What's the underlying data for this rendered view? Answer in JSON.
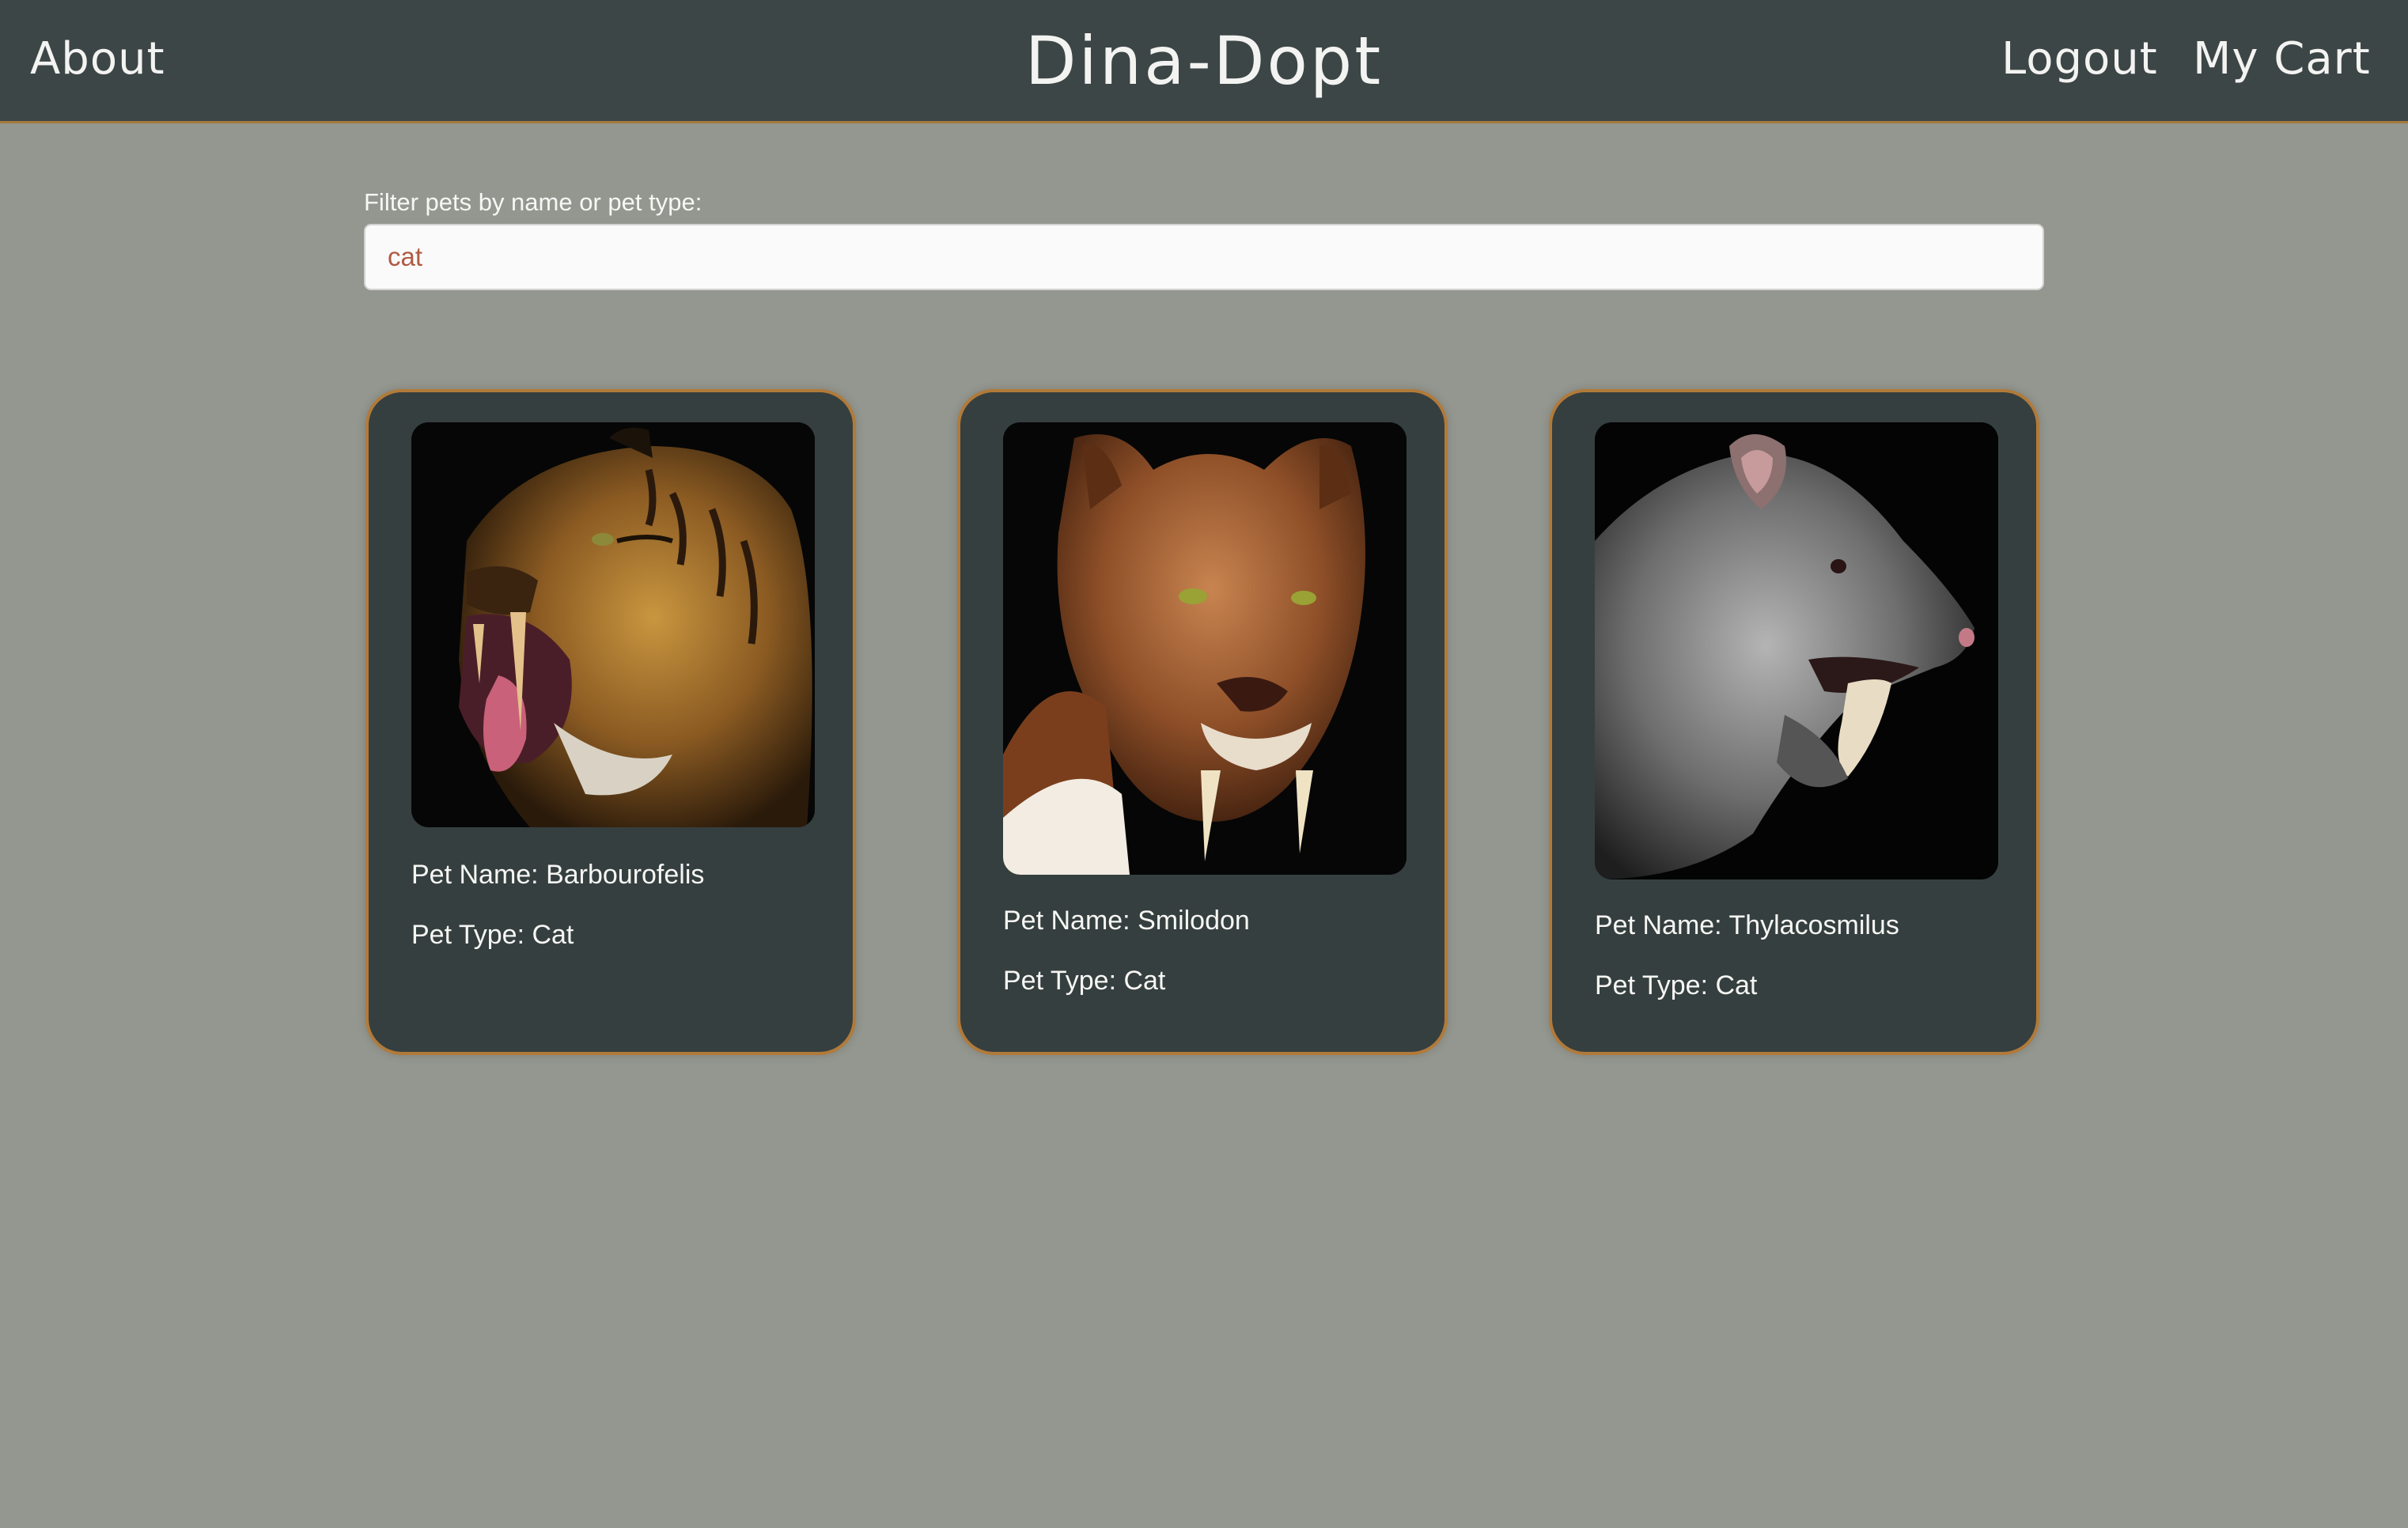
{
  "header": {
    "about_label": "About",
    "brand": "Dina-Dopt",
    "logout_label": "Logout",
    "cart_label": "My Cart"
  },
  "filter": {
    "label": "Filter pets by name or pet type:",
    "value": "cat",
    "placeholder": ""
  },
  "pets": [
    {
      "name_label": "Pet Name: Barbourofelis",
      "type_label": "Pet Type: Cat"
    },
    {
      "name_label": "Pet Name: Smilodon",
      "type_label": "Pet Type: Cat"
    },
    {
      "name_label": "Pet Name: Thylacosmilus",
      "type_label": "Pet Type: Cat"
    }
  ],
  "colors": {
    "page_background": "#939790",
    "header_background": "#3c4646",
    "card_background": "#353f3f",
    "card_border": "#b17a3a",
    "input_text": "#b05a44"
  }
}
